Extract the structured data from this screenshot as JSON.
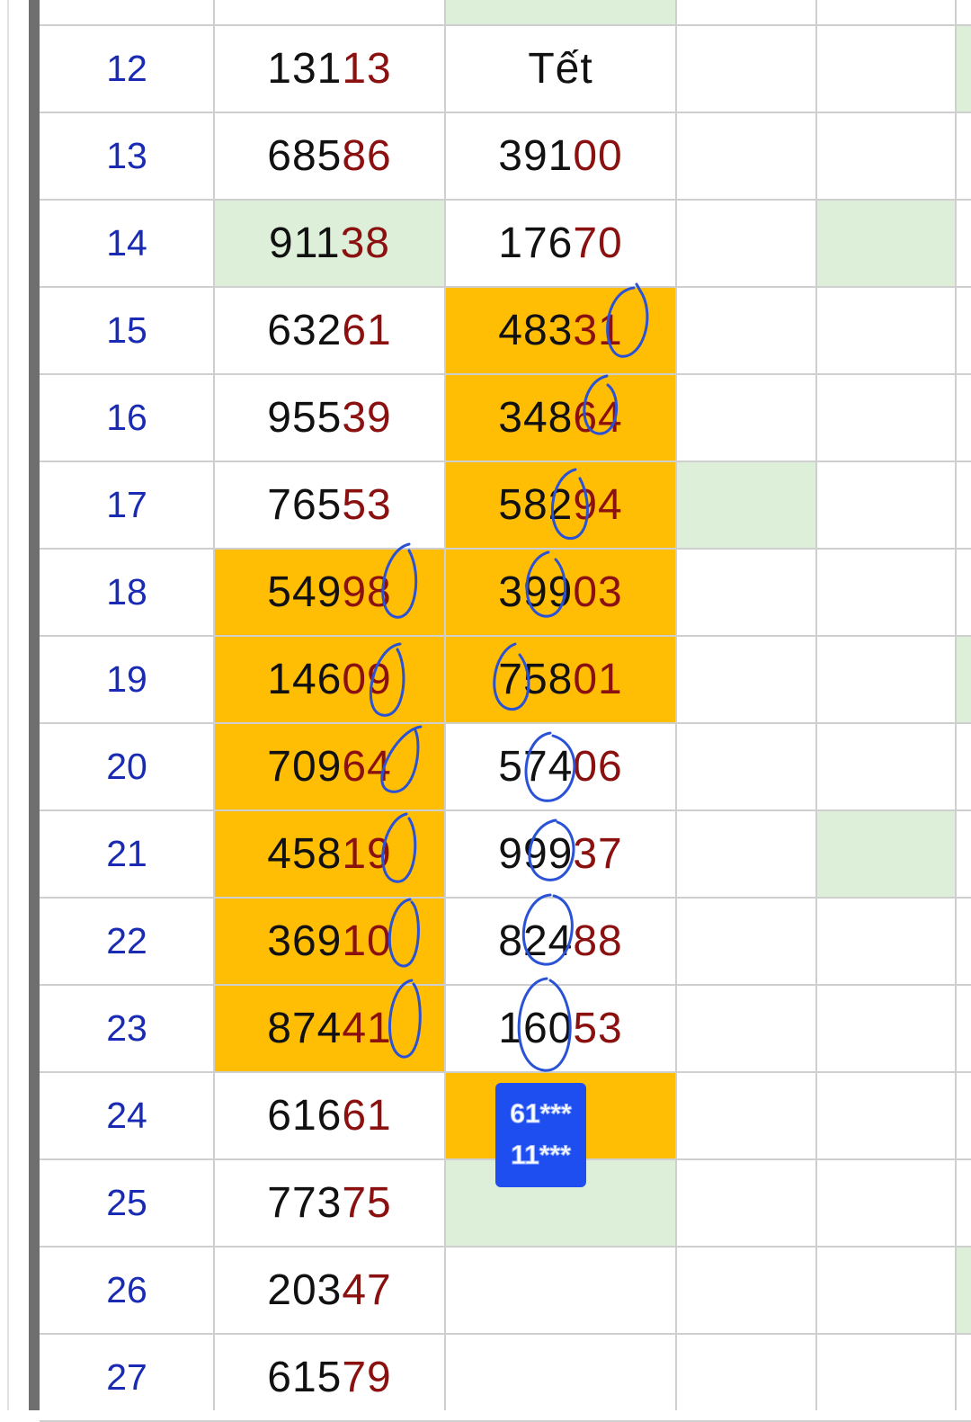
{
  "sheet": {
    "rows": [
      {
        "day": "12",
        "col1": {
          "lead": "131",
          "tail": "13"
        },
        "col2": {
          "text": "Tết"
        }
      },
      {
        "day": "13",
        "col1": {
          "lead": "685",
          "tail": "86"
        },
        "col2": {
          "lead": "391",
          "tail": "00"
        }
      },
      {
        "day": "14",
        "col1": {
          "lead": "911",
          "tail": "38"
        },
        "col2": {
          "lead": "176",
          "tail": "70"
        }
      },
      {
        "day": "15",
        "col1": {
          "lead": "632",
          "tail": "61"
        },
        "col2": {
          "lead": "483",
          "tail": "31"
        }
      },
      {
        "day": "16",
        "col1": {
          "lead": "955",
          "tail": "39"
        },
        "col2": {
          "lead": "348",
          "tail": "64"
        }
      },
      {
        "day": "17",
        "col1": {
          "lead": "765",
          "tail": "53"
        },
        "col2": {
          "lead": "582",
          "tail": "94"
        }
      },
      {
        "day": "18",
        "col1": {
          "lead": "549",
          "tail": "98"
        },
        "col2": {
          "lead": "399",
          "tail": "03"
        }
      },
      {
        "day": "19",
        "col1": {
          "lead": "146",
          "tail": "09"
        },
        "col2": {
          "lead": "758",
          "tail": "01"
        }
      },
      {
        "day": "20",
        "col1": {
          "lead": "709",
          "tail": "64"
        },
        "col2": {
          "lead": "574",
          "tail": "06"
        }
      },
      {
        "day": "21",
        "col1": {
          "lead": "458",
          "tail": "19"
        },
        "col2": {
          "lead": "999",
          "tail": "37"
        }
      },
      {
        "day": "22",
        "col1": {
          "lead": "369",
          "tail": "10"
        },
        "col2": {
          "lead": "824",
          "tail": "88"
        }
      },
      {
        "day": "23",
        "col1": {
          "lead": "874",
          "tail": "41"
        },
        "col2": {
          "lead": "160",
          "tail": "53"
        }
      },
      {
        "day": "24",
        "col1": {
          "lead": "616",
          "tail": "61"
        },
        "col2": null
      },
      {
        "day": "25",
        "col1": {
          "lead": "773",
          "tail": "75"
        },
        "col2": null
      },
      {
        "day": "26",
        "col1": {
          "lead": "203",
          "tail": "47"
        },
        "col2": null
      },
      {
        "day": "27",
        "col1": {
          "lead": "615",
          "tail": "79"
        },
        "col2": null
      }
    ],
    "prediction_badge": {
      "line1": "61***",
      "line2": "11***"
    }
  },
  "colors": {
    "highlight": "#ffbd03",
    "light_green": "#ddefd9",
    "row_number": "#1a2bb3",
    "tail_digits": "#8b1010",
    "ink_circles": "#2a52d6",
    "badge": "#1e4ef0"
  }
}
